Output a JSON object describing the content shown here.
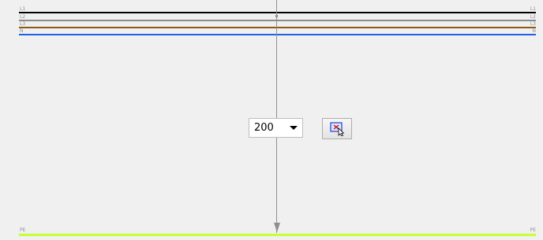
{
  "buses": [
    {
      "left_label": "L1",
      "right_label": "L1",
      "color": "#000000"
    },
    {
      "left_label": "L2",
      "right_label": "L2",
      "color": "#8c8c8c"
    },
    {
      "left_label": "L3",
      "right_label": "L3",
      "color": "#8b5a14"
    },
    {
      "left_label": "N",
      "right_label": "N",
      "color": "#1f5fe6"
    },
    {
      "left_label": "PE",
      "right_label": "PE",
      "color": "#c8ff32"
    }
  ],
  "length_select": {
    "value": "200"
  },
  "icons": {
    "select_tool": "select-region-cursor-icon",
    "dropdown": "chevron-down-icon"
  }
}
